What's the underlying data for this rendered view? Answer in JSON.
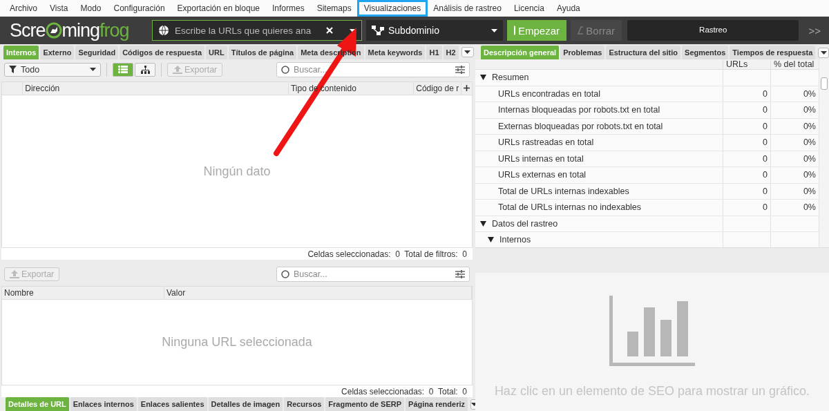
{
  "menu": [
    {
      "label": "Archivo",
      "highlighted": false
    },
    {
      "label": "Vista",
      "highlighted": false
    },
    {
      "label": "Modo",
      "highlighted": false
    },
    {
      "label": "Configuración",
      "highlighted": false
    },
    {
      "label": "Exportación en bloque",
      "highlighted": false
    },
    {
      "label": "Informes",
      "highlighted": false
    },
    {
      "label": "Sitemaps",
      "highlighted": false
    },
    {
      "label": "Visualizaciones",
      "highlighted": true
    },
    {
      "label": "Análisis de rastreo",
      "highlighted": false
    },
    {
      "label": "Licencia",
      "highlighted": false
    },
    {
      "label": "Ayuda",
      "highlighted": false
    }
  ],
  "toolbar": {
    "logo": [
      "Scre",
      "ming",
      "frog"
    ],
    "url_field": {
      "placeholder": "Escribe la URLs que quieres ana"
    },
    "mode": "Subdominio",
    "buttons": [
      {
        "label": "Empezar",
        "kind": "start",
        "disabled": false
      },
      {
        "label": "Borrar",
        "kind": "clear",
        "disabled": true
      }
    ],
    "progress": {
      "label": "Rastreo",
      "level": 0
    },
    "more": ">>"
  },
  "left_tabs": [
    {
      "label": "Internos",
      "selected": true
    },
    {
      "label": "Externo",
      "selected": false
    },
    {
      "label": "Seguridad",
      "selected": false
    },
    {
      "label": "Códigos de respuesta",
      "selected": false
    },
    {
      "label": "URL",
      "selected": false
    },
    {
      "label": "Títulos de página",
      "selected": false
    },
    {
      "label": "Meta description",
      "selected": false
    },
    {
      "label": "Meta keywords",
      "selected": false
    },
    {
      "label": "H1",
      "selected": false
    },
    {
      "label": "H2",
      "selected": false
    }
  ],
  "main_table": {
    "filter": "Todo",
    "views": [
      {
        "kind": "list",
        "selected": true
      },
      {
        "kind": "tree",
        "selected": false
      }
    ],
    "export": {
      "label": "Exportar",
      "disabled": true
    },
    "search": {
      "placeholder": "Buscar..."
    },
    "columns": [
      "Dirección",
      "Tipo de contenido",
      "Código de r"
    ],
    "empty": "Ningún dato",
    "status": "Celdas seleccionadas:  0  Total de filtros:  0"
  },
  "detail_table": {
    "export": {
      "label": "Exportar",
      "disabled": true
    },
    "search": {
      "placeholder": "Buscar..."
    },
    "columns": [
      "Nombre",
      "Valor"
    ],
    "empty": "Ninguna URL seleccionada",
    "status": "Celdas seleccionadas:  0  Total:  0"
  },
  "bottom_tabs": [
    {
      "label": "Detalles de URL",
      "selected": true
    },
    {
      "label": "Enlaces internos",
      "selected": false
    },
    {
      "label": "Enlaces salientes",
      "selected": false
    },
    {
      "label": "Detalles de imagen",
      "selected": false
    },
    {
      "label": "Recursos",
      "selected": false
    },
    {
      "label": "Fragmento de SERP",
      "selected": false
    },
    {
      "label": "Página renderiz",
      "selected": false
    }
  ],
  "right_tabs": [
    {
      "label": "Descripción general",
      "selected": true
    },
    {
      "label": "Problemas",
      "selected": false
    },
    {
      "label": "Estructura del sitio",
      "selected": false
    },
    {
      "label": "Segmentos",
      "selected": false
    },
    {
      "label": "Tiempos de respuesta",
      "selected": false
    }
  ],
  "overview": {
    "columns": [
      "URLs",
      "% del total"
    ],
    "rows": [
      {
        "label": "Resumen",
        "expanded": true,
        "children": [
          {
            "label": "URLs encontradas en total",
            "urls": "0",
            "pct": "0%"
          },
          {
            "label": "Internas bloqueadas por robots.txt en total",
            "urls": "0",
            "pct": "0%"
          },
          {
            "label": "Externas bloqueadas por robots.txt en total",
            "urls": "0",
            "pct": "0%"
          },
          {
            "label": "URLs rastreadas en total",
            "urls": "0",
            "pct": "0%"
          },
          {
            "label": "URLs internas en total",
            "urls": "0",
            "pct": "0%"
          },
          {
            "label": "URLs externas en total",
            "urls": "0",
            "pct": "0%"
          },
          {
            "label": "Total de URLs internas indexables",
            "urls": "0",
            "pct": "0%"
          },
          {
            "label": "Total de URLs internas no indexables",
            "urls": "0",
            "pct": "0%"
          }
        ]
      },
      {
        "label": "Datos del rastreo",
        "expanded": true,
        "children": [
          {
            "label": "Internos",
            "expanded": true
          }
        ]
      }
    ]
  },
  "chart_pane": {
    "message": "Haz clic en un elemento de SEO para mostrar un gráfico."
  },
  "annotations": [
    {
      "kind": "arrow"
    }
  ]
}
